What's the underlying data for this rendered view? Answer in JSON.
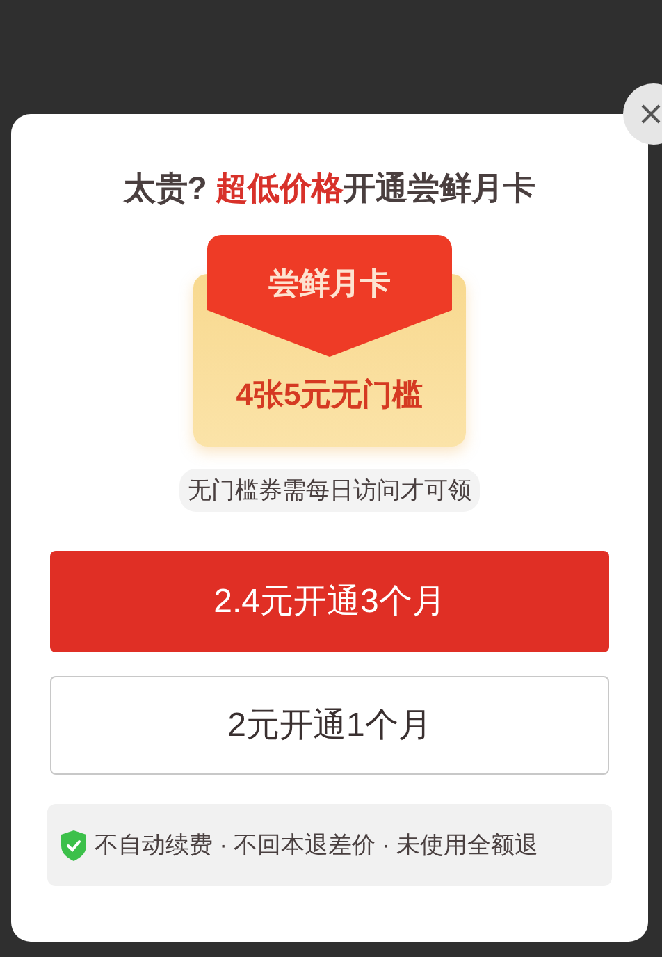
{
  "dialog": {
    "title_parts": [
      {
        "text": "太贵? ",
        "highlight": false
      },
      {
        "text": "超低价格",
        "highlight": true
      },
      {
        "text": "开通尝鲜月卡",
        "highlight": false
      }
    ],
    "card": {
      "name": "尝鲜月卡",
      "offer": "4张5元无门槛"
    },
    "note": "无门槛券需每日访问才可领",
    "buttons": [
      {
        "label": "2.4元开通3个月",
        "kind": "primary"
      },
      {
        "label": "2元开通1个月",
        "kind": "secondary"
      }
    ],
    "guarantee": "不自动续费 · 不回本退差价 · 未使用全额退"
  }
}
